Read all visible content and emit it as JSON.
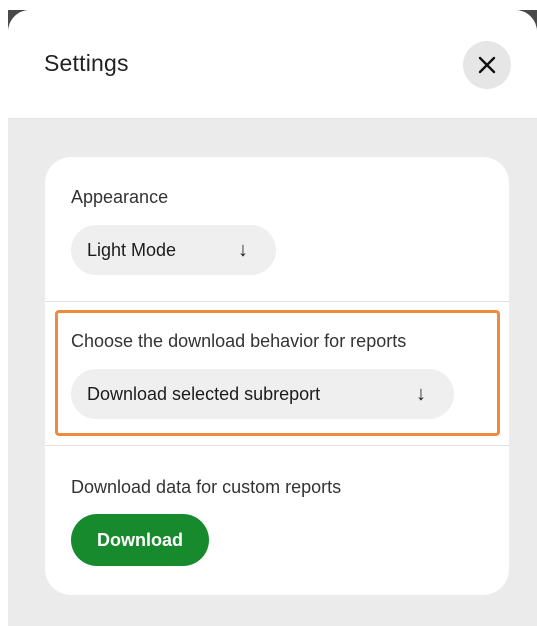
{
  "dialog": {
    "title": "Settings",
    "close_icon": "close-icon"
  },
  "appearance": {
    "label": "Appearance",
    "selected_value": "Light Mode",
    "arrow": "↓"
  },
  "download_behavior": {
    "label": "Choose the download behavior for reports",
    "selected_value": "Download selected subreport",
    "arrow": "↓"
  },
  "custom_reports": {
    "label": "Download data for custom reports",
    "button_label": "Download"
  },
  "colors": {
    "highlight": "#f08a3c",
    "primary_button": "#168a2c",
    "overlay": "#4a4a4a"
  }
}
